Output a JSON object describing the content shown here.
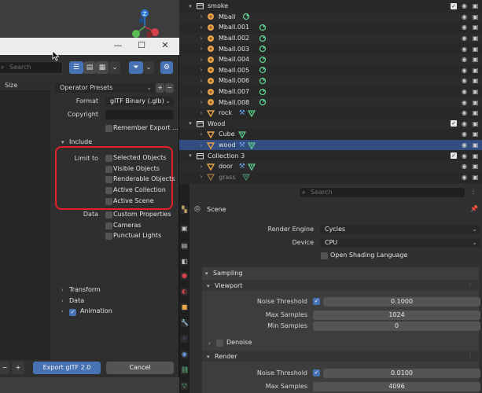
{
  "outliner": {
    "rows": [
      {
        "label": "smoke",
        "kind": "collection",
        "arrow": "▾",
        "indent": 0,
        "check": true
      },
      {
        "label": "Mball",
        "kind": "meta",
        "arrow": "›",
        "indent": 1
      },
      {
        "label": "Mball.001",
        "kind": "meta",
        "arrow": "›",
        "indent": 1
      },
      {
        "label": "Mball.002",
        "kind": "meta",
        "arrow": "›",
        "indent": 1
      },
      {
        "label": "Mball.003",
        "kind": "meta",
        "arrow": "›",
        "indent": 1
      },
      {
        "label": "Mball.004",
        "kind": "meta",
        "arrow": "›",
        "indent": 1
      },
      {
        "label": "Mball.005",
        "kind": "meta",
        "arrow": "›",
        "indent": 1
      },
      {
        "label": "Mball.006",
        "kind": "meta",
        "arrow": "›",
        "indent": 1
      },
      {
        "label": "Mball.007",
        "kind": "meta",
        "arrow": "›",
        "indent": 1
      },
      {
        "label": "Mball.008",
        "kind": "meta",
        "arrow": "›",
        "indent": 1
      },
      {
        "label": "rock",
        "kind": "mesh-mod",
        "arrow": "›",
        "indent": 1
      },
      {
        "label": "Wood",
        "kind": "collection",
        "arrow": "▾",
        "indent": 0,
        "check": true
      },
      {
        "label": "Cube",
        "kind": "mesh",
        "arrow": "›",
        "indent": 1
      },
      {
        "label": "wood",
        "kind": "mesh-mod",
        "arrow": "›",
        "indent": 1,
        "selected": true
      },
      {
        "label": "Collection 3",
        "kind": "collection",
        "arrow": "▾",
        "indent": 0,
        "check": true
      },
      {
        "label": "door",
        "kind": "mesh-mod",
        "arrow": "›",
        "indent": 1
      },
      {
        "label": "grass",
        "kind": "mesh",
        "arrow": "›",
        "indent": 1,
        "dim": true
      }
    ]
  },
  "dialog": {
    "search_placeholder": "Search",
    "filelist_header": "Size",
    "operator_presets": "Operator Presets",
    "add_btn": "+",
    "remove_btn": "−",
    "format_label": "Format",
    "format_value": "glTF Binary (.glb)",
    "copyright_label": "Copyright",
    "copyright_value": "",
    "remember_export": "Remember Export ...",
    "include_header": "Include",
    "limit_to_label": "Limit to",
    "limit_options": [
      "Selected Objects",
      "Visible Objects",
      "Renderable Objects",
      "Active Collection",
      "Active Scene"
    ],
    "data_label": "Data",
    "data_options": [
      "Custom Properties",
      "Cameras",
      "Punctual Lights"
    ],
    "sections": [
      {
        "label": "Transform",
        "checkbox": false
      },
      {
        "label": "Data",
        "checkbox": false
      },
      {
        "label": "Animation",
        "checkbox": true
      }
    ],
    "zoom_out": "−",
    "zoom_in": "+",
    "export_btn": "Export glTF 2.0",
    "cancel_btn": "Cancel"
  },
  "properties": {
    "search_placeholder": "Search",
    "context_title": "Scene",
    "render_engine_label": "Render Engine",
    "render_engine_value": "Cycles",
    "device_label": "Device",
    "device_value": "CPU",
    "osl_label": "Open Shading Language",
    "sampling_header": "Sampling",
    "viewport_header": "Viewport",
    "vp_noise_label": "Noise Threshold",
    "vp_noise_value": "0.1000",
    "vp_max_label": "Max Samples",
    "vp_max_value": "1024",
    "vp_min_label": "Min Samples",
    "vp_min_value": "0",
    "denoise_label": "Denoise",
    "render_header": "Render",
    "r_noise_label": "Noise Threshold",
    "r_noise_value": "0.0100",
    "r_max_label": "Max Samples",
    "r_max_value": "4096"
  },
  "colors": {
    "accent_blue": "#4772b3",
    "highlight_red": "#e0202a",
    "meta_green": "#5fcf8e",
    "mesh_orange": "#e8a34a",
    "modifier_blue": "#6b9fe8",
    "selection_row": "#334d80"
  },
  "icons": {
    "gizmo": "axis-gizmo-icon",
    "collection": "collection-box-icon",
    "meta": "metaball-icon",
    "mesh": "mesh-triangle-icon",
    "modifier": "wrench-icon",
    "material": "material-vertex-icon"
  }
}
